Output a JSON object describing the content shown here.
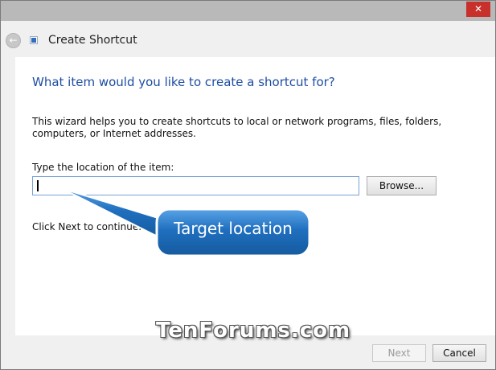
{
  "window": {
    "title": "Create Shortcut",
    "close_symbol": "✕",
    "back_symbol": "←",
    "back_icon": "back-arrow-icon",
    "shortcut_icon": "shortcut-icon"
  },
  "content": {
    "heading": "What item would you like to create a shortcut for?",
    "description": "This wizard helps you to create shortcuts to local or network programs, files, folders, computers, or Internet addresses.",
    "location_label": "Type the location of the item:",
    "location_value": "",
    "browse_label": "Browse...",
    "continue_text": "Click Next to continue."
  },
  "callout": {
    "text": "Target location",
    "color": "#1f6fbf"
  },
  "watermark": "TenForums.com",
  "footer": {
    "next_label": "Next",
    "cancel_label": "Cancel"
  },
  "colors": {
    "heading": "#1e4da3",
    "close_button": "#c7302b",
    "titlebar": "#b9b9b9"
  }
}
